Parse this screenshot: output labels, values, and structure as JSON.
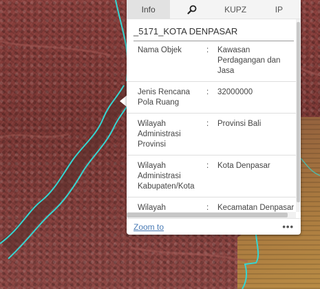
{
  "popup": {
    "tabs": [
      {
        "label": "Info",
        "active": true
      },
      {
        "icon": "search-icon",
        "active": false
      },
      {
        "label": "KUPZ",
        "active": false
      },
      {
        "label": "IP",
        "active": false
      }
    ],
    "layer_title": "_5171_KOTA DENPASAR",
    "separator": ":",
    "attributes": [
      {
        "label": "Nama Objek",
        "value": "Kawasan Perdagangan dan Jasa"
      },
      {
        "label": "Jenis Rencana Pola Ruang",
        "value": "32000000"
      },
      {
        "label": "Wilayah Administrasi Provinsi",
        "value": "Provinsi Bali"
      },
      {
        "label": "Wilayah Administrasi Kabupaten/Kota",
        "value": "Kota Denpasar"
      },
      {
        "label": "Wilayah Administrasi Kecamatan",
        "value": "Kecamatan Denpasar Barat"
      }
    ],
    "footer": {
      "zoom_label": "Zoom to",
      "more_label": "•••"
    }
  },
  "colors": {
    "zone_outline": "#35d6d2",
    "zone_fill": "#8a3f3c",
    "link": "#4a7bb5"
  }
}
